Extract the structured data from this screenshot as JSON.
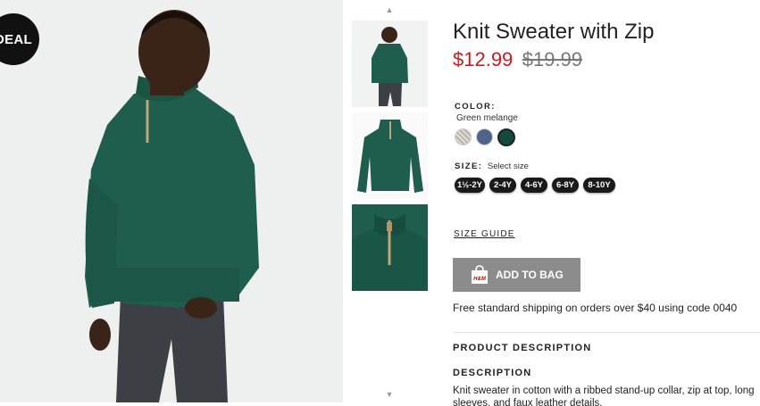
{
  "badge": {
    "label": "DEAL"
  },
  "product": {
    "title": "Knit Sweater with Zip",
    "price_sale": "$12.99",
    "price_original": "$19.99"
  },
  "color": {
    "label": "COLOR:",
    "selected_name": "Green melange",
    "swatches": [
      {
        "name": "light-grey-pattern",
        "color": "#d8d6d0"
      },
      {
        "name": "blue-melange",
        "color": "#4e6489"
      },
      {
        "name": "green-melange",
        "color": "#124a3c"
      }
    ]
  },
  "size": {
    "label": "SIZE:",
    "hint": "Select size",
    "options": [
      "1½-2Y",
      "2-4Y",
      "4-6Y",
      "6-8Y",
      "8-10Y"
    ]
  },
  "size_guide": "SIZE GUIDE",
  "add_to_bag": "ADD TO BAG",
  "bag_icon_text": "H&M",
  "shipping": "Free standard shipping on orders over $40 using code 0040",
  "product_description_heading": "PRODUCT DESCRIPTION",
  "description_heading": "DESCRIPTION",
  "description_text": "Knit sweater in cotton with a ribbed stand-up collar, zip at top, long sleeves, and faux leather details.",
  "colors": {
    "sale": "#d0191f",
    "button": "#8c8c8c",
    "sweater": "#1f5e4c"
  }
}
